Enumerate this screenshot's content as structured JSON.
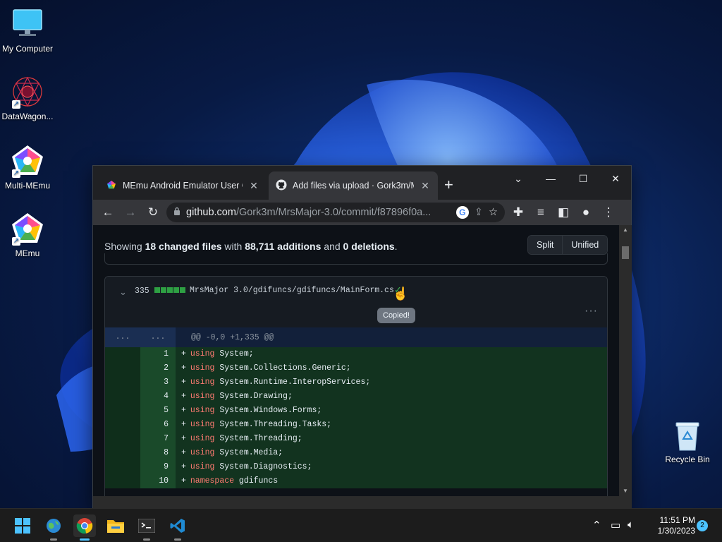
{
  "desktop": {
    "icons": [
      {
        "label": "My Computer",
        "icon": "monitor-icon"
      },
      {
        "label": "DataWagon...",
        "icon": "datawagon-icon"
      },
      {
        "label": "Multi-MEmu",
        "icon": "multi-memu-icon"
      },
      {
        "label": "MEmu",
        "icon": "memu-icon"
      }
    ],
    "recycle_bin": "Recycle Bin"
  },
  "browser": {
    "tabs": [
      {
        "title": "MEmu Android Emulator User Gu",
        "icon": "memu-favicon",
        "active": false
      },
      {
        "title": "Add files via upload · Gork3m/M",
        "icon": "github-favicon",
        "active": true
      }
    ],
    "new_tab": "+",
    "url_host": "github.com",
    "url_path": "/Gork3m/MrsMajor-3.0/commit/f87896f0a..."
  },
  "page": {
    "summary": {
      "prefix": "Showing ",
      "changed": "18 changed files",
      "mid": " with ",
      "additions": "88,711 additions",
      "and": " and ",
      "deletions": "0 deletions",
      "suffix": "."
    },
    "view_modes": [
      "Split",
      "Unified"
    ],
    "file": {
      "count": "335",
      "path": "MrsMajor 3.0/gdifuncs/gdifuncs/MainForm.cs",
      "tooltip": "Copied!",
      "more": "···",
      "hunk_left": "...",
      "hunk_right": "...",
      "hunk_header": "@@ -0,0 +1,335 @@",
      "lines": [
        {
          "num": "1",
          "kw": "using",
          "rest": " System;"
        },
        {
          "num": "2",
          "kw": "using",
          "rest": " System.Collections.Generic;"
        },
        {
          "num": "3",
          "kw": "using",
          "rest": " System.Runtime.InteropServices;"
        },
        {
          "num": "4",
          "kw": "using",
          "rest": " System.Drawing;"
        },
        {
          "num": "5",
          "kw": "using",
          "rest": " System.Windows.Forms;"
        },
        {
          "num": "6",
          "kw": "using",
          "rest": " System.Threading.Tasks;"
        },
        {
          "num": "7",
          "kw": "using",
          "rest": " System.Threading;"
        },
        {
          "num": "8",
          "kw": "using",
          "rest": " System.Media;"
        },
        {
          "num": "9",
          "kw": "using",
          "rest": " System.Diagnostics;"
        },
        {
          "num": "10",
          "kw": "namespace",
          "rest": " gdifuncs"
        }
      ]
    }
  },
  "taskbar": {
    "time": "11:51 PM",
    "date": "1/30/2023",
    "notifications": "2"
  },
  "colors": {
    "accent": "#4cc2ff",
    "diff_add_bg": "#12331f",
    "keyword": "#ff7b72"
  }
}
